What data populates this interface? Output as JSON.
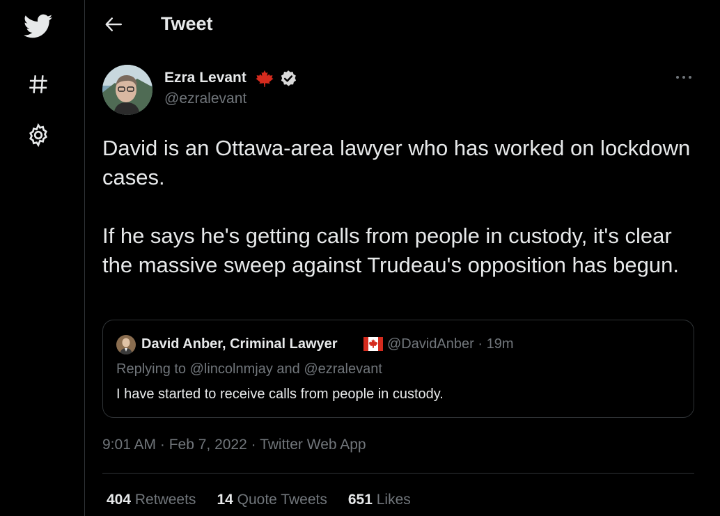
{
  "sidebar": {
    "icons": [
      "twitter-logo-icon",
      "hashtag-icon",
      "gear-icon"
    ]
  },
  "header": {
    "back_icon": "back-arrow-icon",
    "title": "Tweet"
  },
  "tweet": {
    "author_name": "Ezra Levant",
    "handle": "@ezralevant",
    "paragraphs": [
      "David is an Ottawa-area lawyer who has worked on lockdown cases.",
      "If he says he's getting calls from people in custody, it's clear the massive sweep against Trudeau's opposition has begun."
    ],
    "more_icon": "more-options-icon",
    "quote": {
      "author_name": "David Anber, Criminal Lawyer",
      "handle_time": "@DavidAnber · 19m",
      "replying_to": "Replying to @lincolnmjay and @ezralevant",
      "text": "I have started to receive calls from people in custody."
    },
    "meta": "9:01 AM · Feb 7, 2022 · Twitter Web App",
    "stats": {
      "retweets_count": "404",
      "retweets_label": "Retweets",
      "quotes_count": "14",
      "quotes_label": "Quote Tweets",
      "likes_count": "651",
      "likes_label": "Likes"
    }
  },
  "colors": {
    "background": "#000000",
    "text_primary": "#e7e9ea",
    "text_secondary": "#71767b",
    "border": "#2f3336",
    "verified_badge": "#d9d9d9",
    "canada_red": "#d52b1e"
  }
}
